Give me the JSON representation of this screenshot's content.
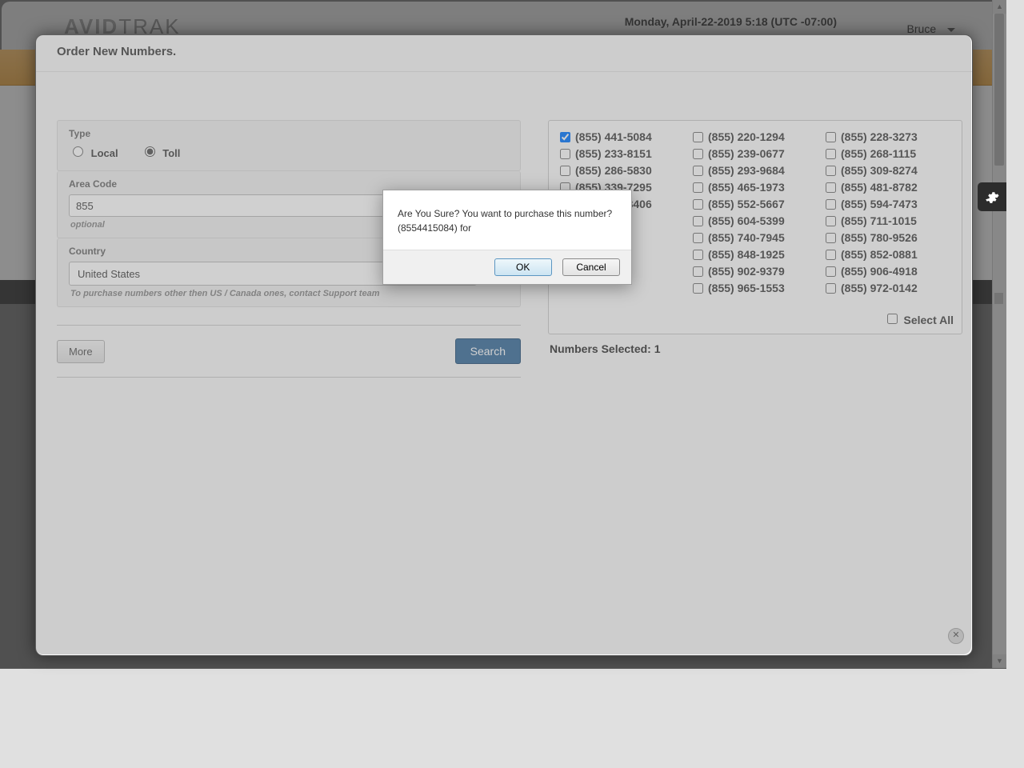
{
  "header": {
    "brand_prefix": "AVID",
    "brand_suffix": "TRAK",
    "datetime": "Monday, April-22-2019 5:18 (UTC -07:00)",
    "username": "Bruce"
  },
  "modal": {
    "title": "Order New Numbers.",
    "type_label": "Type",
    "local_label": "Local",
    "toll_label": "Toll",
    "areacode_label": "Area Code",
    "areacode_value": "855",
    "areacode_hint": "optional",
    "country_label": "Country",
    "country_value": "United States",
    "country_hint": "To purchase numbers other then US / Canada ones, contact Support team",
    "more_label": "More",
    "search_label": "Search",
    "select_all_label": "Select All",
    "selected_prefix": "Numbers Selected: ",
    "selected_count": "1"
  },
  "numbers": [
    {
      "label": "(855) 441-5084",
      "checked": true
    },
    {
      "label": "(855) 220-1294",
      "checked": false
    },
    {
      "label": "(855) 228-3273",
      "checked": false
    },
    {
      "label": "(855) 233-8151",
      "checked": false
    },
    {
      "label": "(855) 239-0677",
      "checked": false
    },
    {
      "label": "(855) 268-1115",
      "checked": false
    },
    {
      "label": "(855) 286-5830",
      "checked": false
    },
    {
      "label": "(855) 293-9684",
      "checked": false
    },
    {
      "label": "(855) 309-8274",
      "checked": false
    },
    {
      "label": "(855) 339-7295",
      "checked": false
    },
    {
      "label": "(855) 465-1973",
      "checked": false
    },
    {
      "label": "(855) 481-8782",
      "checked": false
    },
    {
      "label": "(855) 507-8406",
      "checked": false
    },
    {
      "label": "(855) 552-5667",
      "checked": false
    },
    {
      "label": "(855) 594-7473",
      "checked": false
    },
    {
      "label": "",
      "checked": false,
      "empty": true
    },
    {
      "label": "(855) 604-5399",
      "checked": false
    },
    {
      "label": "(855) 711-1015",
      "checked": false
    },
    {
      "label": "",
      "checked": false,
      "empty": true
    },
    {
      "label": "(855) 740-7945",
      "checked": false
    },
    {
      "label": "(855) 780-9526",
      "checked": false
    },
    {
      "label": "",
      "checked": false,
      "empty": true
    },
    {
      "label": "(855) 848-1925",
      "checked": false
    },
    {
      "label": "(855) 852-0881",
      "checked": false
    },
    {
      "label": "",
      "checked": false,
      "empty": true
    },
    {
      "label": "(855) 902-9379",
      "checked": false
    },
    {
      "label": "(855) 906-4918",
      "checked": false
    },
    {
      "label": "",
      "checked": false,
      "empty": true
    },
    {
      "label": "(855) 965-1553",
      "checked": false
    },
    {
      "label": "(855) 972-0142",
      "checked": false
    }
  ],
  "confirm": {
    "message_line1": "Are You Sure? You want to purchase this number?",
    "message_line2": "(8554415084) for",
    "ok": "OK",
    "cancel": "Cancel"
  }
}
